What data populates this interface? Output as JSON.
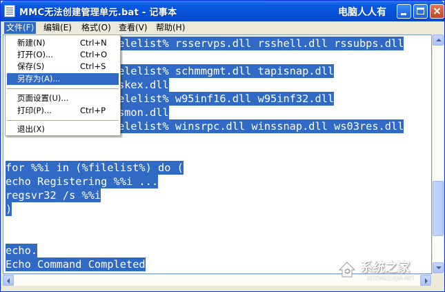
{
  "window": {
    "title": "MMC无法创建管理单元.bat - 记事本",
    "watermark_top": "电脑人人有"
  },
  "menubar": {
    "file": "文件(F)",
    "edit": "编辑(E)",
    "format": "格式(O)",
    "view": "查看(V)",
    "help": "帮助(H)"
  },
  "file_menu": {
    "new": "新建(N)",
    "new_shortcut": "Ctrl+N",
    "open": "打开(O)...",
    "open_shortcut": "Ctrl+O",
    "save": "保存(S)",
    "save_shortcut": "Ctrl+S",
    "save_as": "另存为(A)...",
    "page_setup": "页面设置(U)...",
    "print": "打印(P)...",
    "print_shortcut": "Ctrl+P",
    "exit": "退出(X)"
  },
  "editor": {
    "lines": [
      "elelist% rsservps.dll rsshell.dll rssubps.dll",
      "elelist% schmmgmt.dll tapisnap.dll",
      "skex.dll",
      "elelist% w95inf16.dll w95inf32.dll",
      "smon.dll",
      "elelist% winsrpc.dll winssnap.dll ws03res.dll",
      "for %%i in (%filelist%) do (",
      "echo Registering %%i ...",
      "regsvr32 /s %%i",
      ")",
      "echo.",
      "Echo Command Completed"
    ]
  },
  "watermark": {
    "brand": "系统之家",
    "url": "XITONGZHIJIA.NET"
  },
  "colors": {
    "selection": "#316ac5",
    "titlebar": "#0a5ae0",
    "close_button": "#c64421"
  }
}
